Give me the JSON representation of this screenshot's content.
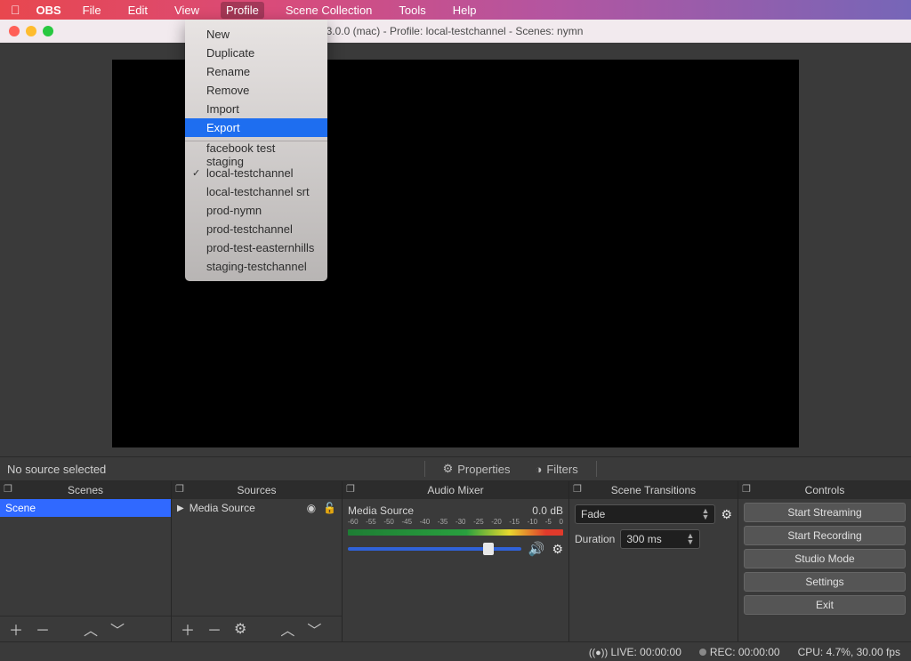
{
  "menubar": {
    "app": "OBS",
    "items": [
      "File",
      "Edit",
      "View",
      "Profile",
      "Scene Collection",
      "Tools",
      "Help"
    ],
    "active": "Profile"
  },
  "window": {
    "title": "3.0.0 (mac) - Profile: local-testchannel - Scenes: nymn"
  },
  "profile_menu": {
    "actions": [
      "New",
      "Duplicate",
      "Rename",
      "Remove",
      "Import",
      "Export"
    ],
    "highlighted": "Export",
    "profiles": [
      "facebook test staging",
      "local-testchannel",
      "local-testchannel srt",
      "prod-nymn",
      "prod-testchannel",
      "prod-test-easternhills",
      "staging-testchannel"
    ],
    "checked": "local-testchannel"
  },
  "prop_row": {
    "label": "No source selected",
    "properties": "Properties",
    "filters": "Filters"
  },
  "docks": {
    "scenes": {
      "title": "Scenes",
      "items": [
        "Scene"
      ]
    },
    "sources": {
      "title": "Sources",
      "items": [
        {
          "name": "Media Source"
        }
      ]
    },
    "mixer": {
      "title": "Audio Mixer",
      "item": {
        "name": "Media Source",
        "level": "0.0 dB"
      },
      "ticks": [
        "-60",
        "-55",
        "-50",
        "-45",
        "-40",
        "-35",
        "-30",
        "-25",
        "-20",
        "-15",
        "-10",
        "-5",
        "0"
      ]
    },
    "transitions": {
      "title": "Scene Transitions",
      "selected": "Fade",
      "duration_label": "Duration",
      "duration": "300 ms"
    },
    "controls": {
      "title": "Controls",
      "buttons": [
        "Start Streaming",
        "Start Recording",
        "Studio Mode",
        "Settings",
        "Exit"
      ]
    }
  },
  "status": {
    "live": "LIVE: 00:00:00",
    "rec": "REC: 00:00:00",
    "cpu": "CPU: 4.7%, 30.00 fps"
  }
}
